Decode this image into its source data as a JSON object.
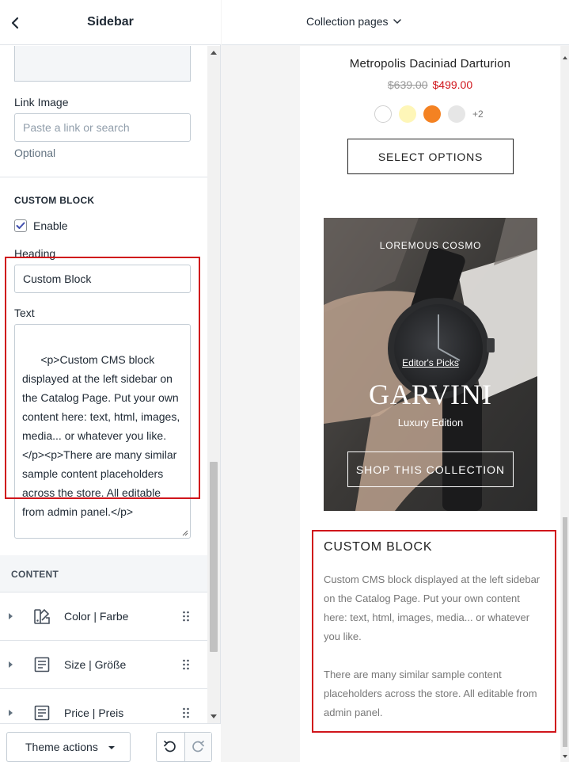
{
  "left_panel": {
    "title": "Sidebar",
    "link_image": {
      "label": "Link Image",
      "placeholder": "Paste a link or search",
      "help": "Optional"
    },
    "custom_block": {
      "section_title": "CUSTOM BLOCK",
      "enable_label": "Enable",
      "enabled": true,
      "heading_label": "Heading",
      "heading_value": "Custom Block",
      "text_label": "Text",
      "text_value": "<p>Custom CMS block displayed at the left sidebar on the Catalog Page. Put your own content here: text, html, images, media... or whatever you like.</p><p>There are many similar sample content placeholders across the store. All editable from admin panel.</p>"
    },
    "content": {
      "section_title": "CONTENT",
      "blocks": [
        {
          "label": "Color | Farbe",
          "icon": "color-swatch-icon"
        },
        {
          "label": "Size | Größe",
          "icon": "text-block-icon"
        },
        {
          "label": "Price | Preis",
          "icon": "text-block-icon"
        }
      ]
    },
    "footer": {
      "theme_actions_label": "Theme actions"
    }
  },
  "right_panel": {
    "page_selector": "Collection pages",
    "product": {
      "name": "Metropolis Daciniad Darturion",
      "old_price": "$639.00",
      "new_price": "$499.00",
      "swatches": [
        "#ffffff",
        "#fef6b8",
        "#f48222",
        "#e6e6e6"
      ],
      "more_swatches": "+2",
      "select_button": "SELECT OPTIONS"
    },
    "banner": {
      "subtitle": "LOREMOUS COSMO",
      "pick": "Editor's Picks",
      "title": "GARVINI",
      "edition": "Luxury Edition",
      "button": "SHOP THIS COLLECTION"
    },
    "custom_block": {
      "title": "CUSTOM BLOCK",
      "paragraphs": [
        "Custom CMS block displayed at the left sidebar on the Catalog Page. Put your own content here: text, html, images, media... or whatever you like.",
        "There are many similar sample content placeholders across the store. All editable from admin panel."
      ]
    }
  },
  "colors": {
    "highlight": "#d0151b",
    "sale_price": "#d0151b",
    "border": "#c4cdd5"
  }
}
